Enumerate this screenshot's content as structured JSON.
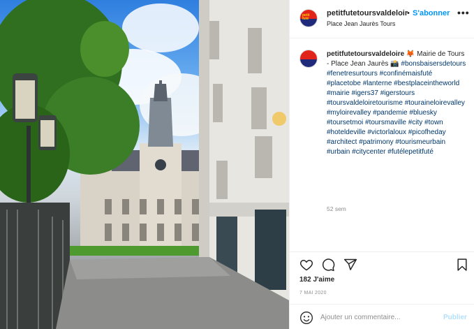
{
  "post": {
    "account": {
      "username": "petitfutetoursvaldeloir",
      "username_full": "petitfutetoursvaldeloire",
      "follow_label": "S'abonner",
      "separator": "•",
      "avatar_text": "petit futé"
    },
    "location": "Place Jean Jaurès Tours",
    "caption": {
      "text": "🦊 Mairie de Tours - Place Jean Jaurès 📸",
      "hashtags": "#bonsbaisersdetours #fenetresurtours #confinémaisfuté #placetobe #lanterne #bestplaceintheworld #mairie #igers37 #igerstours #toursvaldeloiretourisme #touraineloirevalley #myloirevalley #pandemie #bluesky #toursetmoi #toursmaville #city #town #hoteldeville #victorlaloux #picofheday #architect #patrimony #tourismeurbain #urbain #citycenter #futélepetitfuté",
      "time_ago": "52 sem"
    },
    "likes": "182 J'aime",
    "date": "7 MAI 2020",
    "comment": {
      "placeholder": "Ajouter un commentaire...",
      "publish_label": "Publier"
    }
  },
  "icons": {
    "more": "more-options-icon",
    "like": "heart-icon",
    "comment": "comment-icon",
    "share": "share-icon",
    "save": "bookmark-icon",
    "emoji": "emoji-icon"
  },
  "colors": {
    "follow": "#0095f6",
    "hashtag": "#00376b",
    "muted": "#8e8e8e",
    "publish_disabled": "#b2dffc"
  }
}
